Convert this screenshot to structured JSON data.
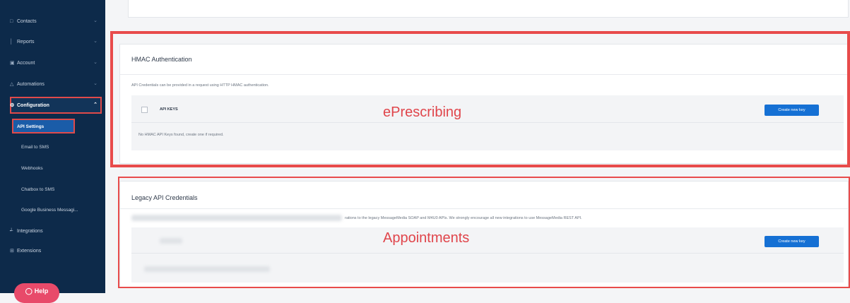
{
  "sidebar": {
    "items": [
      {
        "label": "Contacts",
        "icon": "□"
      },
      {
        "label": "Reports",
        "icon": "│"
      },
      {
        "label": "Account",
        "icon": "▣"
      },
      {
        "label": "Automations",
        "icon": "△"
      },
      {
        "label": "Configuration",
        "icon": "⚙"
      }
    ],
    "sub_items": [
      "API Settings",
      "Email to SMS",
      "Webhooks",
      "Chatbox to SMS",
      "Google Business Messagi..."
    ],
    "bottom_items": [
      {
        "label": "Integrations",
        "icon": "┵"
      },
      {
        "label": "Extensions",
        "icon": "⊞"
      }
    ],
    "help_label": "Help"
  },
  "hmac": {
    "title": "HMAC Authentication",
    "description": "API Credentials can be provided in a request using HTTP HMAC authentication.",
    "api_keys_label": "API KEYS",
    "create_button": "Create new key",
    "empty_text": "No HMAC API Keys found, create one if required."
  },
  "legacy": {
    "title": "Legacy API Credentials",
    "description": "rations to the legacy MessageMedia SOAP and M4U0 APIs. We strongly encourage all new integrations to use MessageMedia REST API.",
    "create_button": "Create new key"
  },
  "annotations": {
    "eprescribing": "ePrescribing",
    "appointments": "Appointments"
  },
  "colors": {
    "sidebar_bg": "#0d2a4a",
    "accent_blue": "#1570d4",
    "annotation_red": "#e0454b"
  }
}
